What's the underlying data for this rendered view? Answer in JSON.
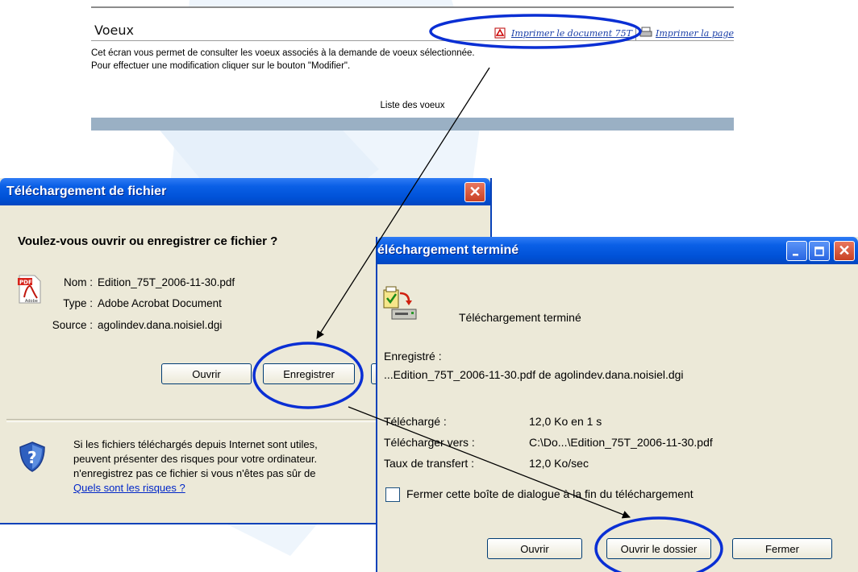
{
  "web": {
    "title": "Voeux",
    "link_print_doc": "Imprimer le document 75T",
    "link_print_page": "Imprimer la page",
    "desc_line1": "Cet écran vous permet de consulter les voeux associés à la demande de voeux sélectionnée.",
    "desc_line2": "Pour effectuer une modification cliquer sur le bouton \"Modifier\".",
    "list_title": "Liste des voeux"
  },
  "download_dialog": {
    "title": "Téléchargement de fichier",
    "question": "Voulez-vous ouvrir ou enregistrer ce fichier ?",
    "name_label": "Nom :",
    "name_value": "Edition_75T_2006-11-30.pdf",
    "type_label": "Type :",
    "type_value": "Adobe Acrobat Document",
    "source_label": "Source :",
    "source_value": "agolindev.dana.noisiel.dgi",
    "open_button": "Ouvrir",
    "save_button": "Enregistrer",
    "warning_line1": "Si les fichiers téléchargés depuis Internet sont utiles,",
    "warning_line2": "peuvent présenter des risques pour votre ordinateur.",
    "warning_line3": "n'enregistrez pas ce fichier si vous n'êtes pas sûr de",
    "risk_link": "Quels sont les risques ?",
    "pdf_icon_label": "PDF",
    "adobe_label": "Adobe"
  },
  "complete_dialog": {
    "title": "éléchargement terminé",
    "message": "Téléchargement terminé",
    "saved_label": "Enregistré :",
    "saved_value": "...Edition_75T_2006-11-30.pdf de agolindev.dana.noisiel.dgi",
    "downloaded_label": "Téléchargé :",
    "downloaded_value": "12,0 Ko en 1 s",
    "download_to_label": "Télécharger vers :",
    "download_to_value": "C:\\Do...\\Edition_75T_2006-11-30.pdf",
    "rate_label": "Taux de transfert :",
    "rate_value": "12,0 Ko/sec",
    "close_when_done": "Fermer cette boîte de dialogue à la fin du téléchargement",
    "close_when_done_checked": false,
    "open_button": "Ouvrir",
    "open_folder_button": "Ouvrir le dossier",
    "close_button": "Fermer"
  },
  "icons": {
    "close": "close-icon",
    "minimize": "minimize-icon",
    "maximize": "maximize-icon",
    "shield": "shield-question-icon",
    "pdf": "pdf-file-icon",
    "download_complete": "download-complete-icon",
    "printer": "printer-icon"
  },
  "colors": {
    "xp_title_blue": "#0052d8",
    "dialog_bg": "#ece9d8",
    "annotation_blue": "#0a2fd4",
    "link_blue": "#1a3fa8"
  }
}
